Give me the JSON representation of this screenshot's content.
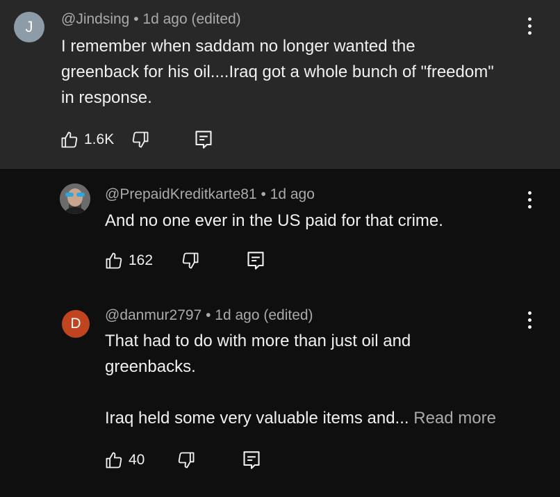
{
  "comments": [
    {
      "avatar_letter": "J",
      "avatar_color": "#8d9ca7",
      "author": "@Jindsing",
      "time": "1d ago (edited)",
      "lines": [
        "I remember when saddam  no longer wanted the",
        "greenback for his oil....Iraq got a whole bunch of \"freedom\"",
        "in response."
      ],
      "likes": "1.6K"
    },
    {
      "avatar_letter": "",
      "author": "@PrepaidKreditkarte81",
      "time": "1d ago",
      "lines": [
        "And no one ever in the US paid for that crime."
      ],
      "likes": "162"
    },
    {
      "avatar_letter": "D",
      "avatar_color": "#c0441f",
      "author": "@danmur2797",
      "time": "1d ago (edited)",
      "lines": [
        "That had to do with more than just oil and",
        "greenbacks."
      ],
      "last_line": "Iraq held some very valuable items and... ",
      "read_more": "Read more",
      "likes": "40"
    }
  ],
  "separator": " • ",
  "icons": [
    "thumb-up-icon",
    "thumb-down-icon",
    "reply-icon",
    "more-vert-icon"
  ],
  "colors": {
    "top_bg": "#282828",
    "page_bg": "#0f0f0f",
    "meta": "#aaaaaa"
  }
}
